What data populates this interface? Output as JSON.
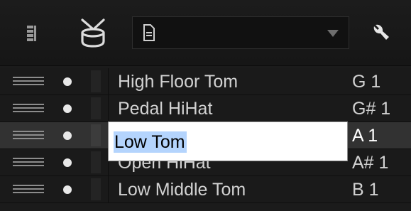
{
  "toolbar": {
    "list_icon": "list-view-icon",
    "drum_icon": "drum-icon",
    "preset": {
      "icon": "document-icon",
      "value": ""
    },
    "dropdown_icon": "chevron-down-icon",
    "settings_icon": "wrench-icon"
  },
  "rows": [
    {
      "name": "High Floor Tom",
      "note": "G 1",
      "selected": false
    },
    {
      "name": "Pedal HiHat",
      "note": "G# 1",
      "selected": false
    },
    {
      "name": "Low Tom",
      "note": "A 1",
      "selected": true
    },
    {
      "name": "Open HiHat",
      "note": "A# 1",
      "selected": false
    },
    {
      "name": "Low Middle Tom",
      "note": "B 1",
      "selected": false
    }
  ],
  "editor": {
    "value": "Low Tom"
  },
  "colors": {
    "background": "#1b1b1b",
    "selected_row": "#323232",
    "text": "#d2d2d2",
    "text_selection": "#b4d4fd"
  }
}
